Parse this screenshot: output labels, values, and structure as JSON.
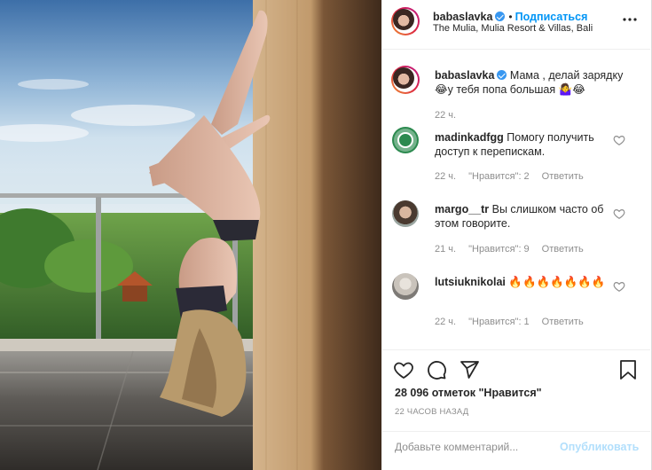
{
  "post": {
    "author": {
      "username": "babaslavka",
      "follow_separator": "•",
      "follow_label": "Подписаться",
      "location": "The Mulia, Mulia Resort & Villas, Bali"
    },
    "caption": {
      "username": "babaslavka",
      "text": "Мама , делай зарядку 😂у тебя попа большая 🤷‍♀️😂",
      "time": "22 ч."
    },
    "comments": [
      {
        "username": "madinkadfgg",
        "text": "Помогу получить доступ к перепискам.",
        "time": "22 ч.",
        "likes": "\"Нравится\": 2",
        "reply": "Ответить"
      },
      {
        "username": "margo__tr",
        "text": "Вы слишком часто об этом говорите.",
        "time": "21 ч.",
        "likes": "\"Нравится\": 9",
        "reply": "Ответить"
      },
      {
        "username": "lutsiuknikolai",
        "text": "🔥🔥🔥🔥🔥🔥🔥",
        "time": "22 ч.",
        "likes": "\"Нравится\": 1",
        "reply": "Ответить"
      }
    ],
    "likes_text": "28 096 отметок \"Нравится\"",
    "posted_time": "22 ЧАСОВ НАЗАД",
    "add_comment": {
      "placeholder": "Добавьте комментарий...",
      "publish_label": "Опубликовать"
    }
  },
  "icons": {
    "header": [
      "avatar",
      "verified-badge",
      "more-options-icon"
    ],
    "actions": [
      "like-icon",
      "comment-icon",
      "share-icon",
      "bookmark-icon"
    ],
    "comment": [
      "comment-like-icon"
    ]
  },
  "colors": {
    "follow_blue": "#0095f6",
    "verified_blue": "#3897f0",
    "publish_disabled": "#b2dffc",
    "secondary_text": "#8e8e8e",
    "primary_text": "#262626"
  }
}
